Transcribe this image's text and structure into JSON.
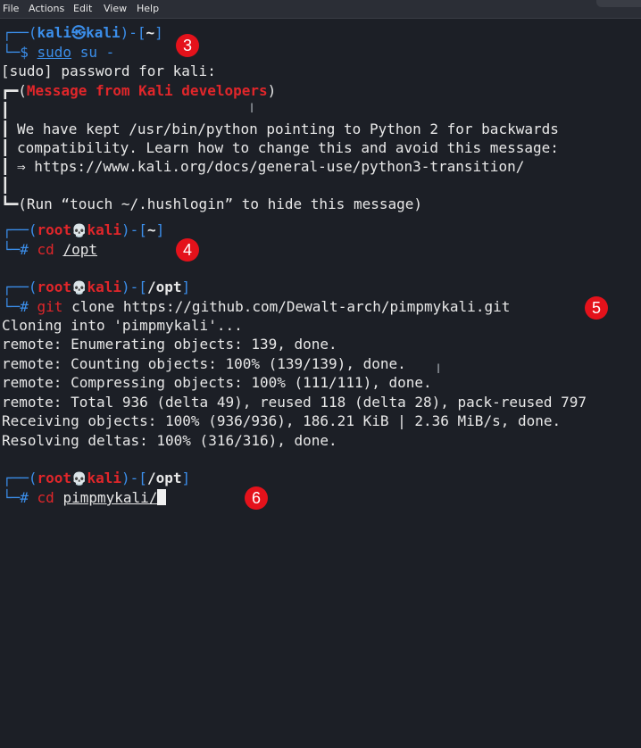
{
  "menubar": {
    "items": [
      "File",
      "Actions",
      "Edit",
      "View",
      "Help"
    ]
  },
  "colors": {
    "background": "#1c1f26",
    "user_prompt_blue": "#3b8eea",
    "root_prompt_red": "#e0262a",
    "badge_red": "#e4121b",
    "text": "#e8e8e8"
  },
  "terminal": {
    "prompt1": {
      "corner": "┌──(",
      "user": "kali",
      "at": "㉿",
      "host": "kali",
      "mid": ")-[",
      "dir": "~",
      "end": "]",
      "cmd_prefix": "└─$ ",
      "cmd_word": "sudo",
      "cmd_rest": " su -"
    },
    "password_line": "[sudo] password for kali:",
    "message": {
      "head_corner": "┏━(",
      "title": "Message from Kali developers",
      "head_end": ")",
      "bar": "┃",
      "lines": [
        "We have kept /usr/bin/python pointing to Python 2 for backwards",
        "compatibility. Learn how to change this and avoid this message:",
        "⇒ https://www.kali.org/docs/general-use/python3-transition/"
      ],
      "foot_corner": "┗━",
      "footer": "(Run “touch ~/.hushlogin” to hide this message)"
    },
    "prompt2": {
      "corner": "┌──(",
      "user": "root",
      "skull": "💀",
      "host": "kali",
      "mid": ")-[",
      "dir": "~",
      "end": "]",
      "cmd_prefix": "└─# ",
      "cmd_word": "cd",
      "cmd_arg": "/opt"
    },
    "prompt3": {
      "corner": "┌──(",
      "user": "root",
      "skull": "💀",
      "host": "kali",
      "mid": ")-[",
      "dir": "/opt",
      "end": "]",
      "cmd_prefix": "└─# ",
      "cmd_word": "git",
      "cmd_rest": " clone https://github.com/Dewalt-arch/pimpmykali.git"
    },
    "git_output": [
      "Cloning into 'pimpmykali'...",
      "remote: Enumerating objects: 139, done.",
      "remote: Counting objects: 100% (139/139), done.",
      "remote: Compressing objects: 100% (111/111), done.",
      "remote: Total 936 (delta 49), reused 118 (delta 28), pack-reused 797",
      "Receiving objects: 100% (936/936), 186.21 KiB | 2.36 MiB/s, done.",
      "Resolving deltas: 100% (316/316), done."
    ],
    "prompt4": {
      "corner": "┌──(",
      "user": "root",
      "skull": "💀",
      "host": "kali",
      "mid": ")-[",
      "dir": "/opt",
      "end": "]",
      "cmd_prefix": "└─# ",
      "cmd_word": "cd",
      "cmd_arg": "pimpmykali/"
    }
  },
  "annotations": [
    "3",
    "4",
    "5",
    "6"
  ],
  "ibeam_glyph": "I"
}
